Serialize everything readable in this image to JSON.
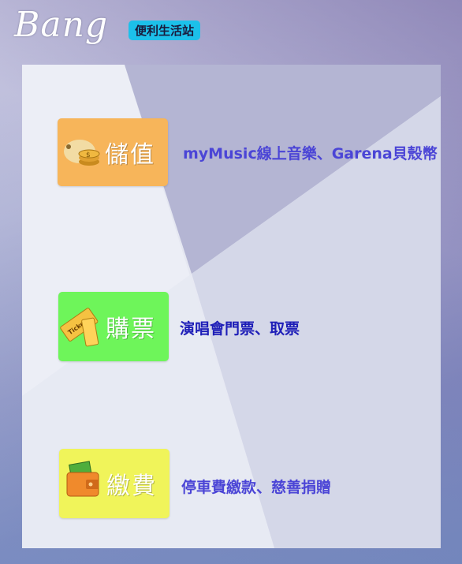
{
  "header": {
    "logo": "Bang",
    "tag": "便利生活站"
  },
  "services": [
    {
      "label": "儲值",
      "description": "myMusic線上音樂、Garena貝殼幣",
      "bg": "#f7b55a",
      "desc_color": "#4b45d6"
    },
    {
      "label": "購票",
      "description": "演唱會門票、取票",
      "bg": "#6ef55a",
      "desc_color": "#1f1fb8"
    },
    {
      "label": "繳費",
      "description": "停車費繳款、慈善捐贈",
      "bg": "#f0f45a",
      "desc_color": "#4b45d6"
    }
  ]
}
